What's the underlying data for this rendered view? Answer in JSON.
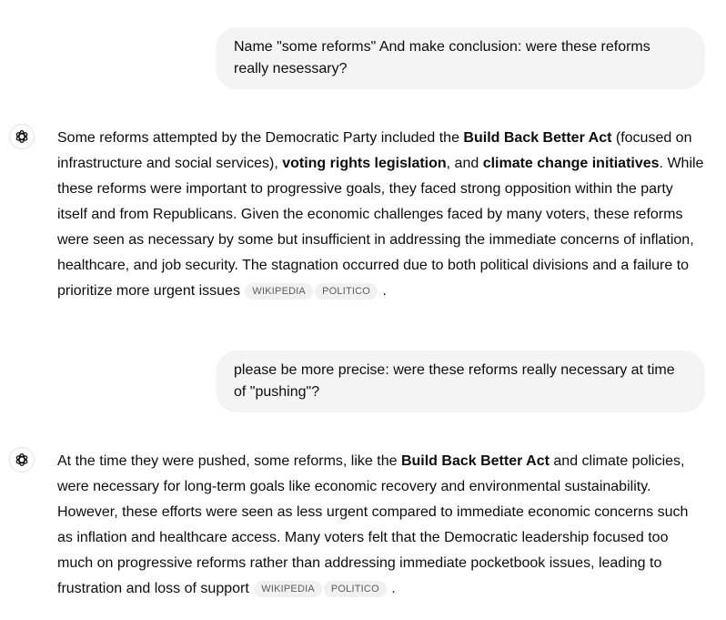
{
  "messages": [
    {
      "role": "user",
      "text": "Name \"some reforms\" And make conclusion: were these reforms really nesessary?"
    },
    {
      "role": "assistant",
      "segments": {
        "s1": "Some reforms attempted by the Democratic Party included the ",
        "b1": "Build Back Better Act",
        "s2": " (focused on infrastructure and social services), ",
        "b2": "voting rights legislation",
        "s3": ", and ",
        "b3": "climate change initiatives",
        "s4": ". While these reforms were important to progressive goals, they faced strong opposition within the party itself and from Republicans. Given the economic challenges faced by many voters, these reforms were seen as necessary by some but insufficient in addressing the immediate concerns of inflation, healthcare, and job security. The stagnation occurred due to both political divisions and a failure to prioritize more urgent issues",
        "end": " ."
      },
      "sources": [
        "WIKIPEDIA",
        "POLITICO"
      ]
    },
    {
      "role": "user",
      "text": "please be more precise: were these reforms really necessary at time of \"pushing\"?"
    },
    {
      "role": "assistant",
      "segments": {
        "s1": "At the time they were pushed, some reforms, like the ",
        "b1": "Build Back Better Act",
        "s2": " and climate policies, were necessary for long-term goals like economic recovery and environmental sustainability. However, these efforts were seen as less urgent compared to immediate economic concerns such as inflation and healthcare access. Many voters felt that the Democratic leadership focused too much on progressive reforms rather than addressing immediate pocketbook issues, leading to frustration and loss of support",
        "end": " ."
      },
      "sources": [
        "WIKIPEDIA",
        "POLITICO"
      ]
    }
  ],
  "icons": {
    "assistant_avatar": "openai-logo-icon"
  }
}
